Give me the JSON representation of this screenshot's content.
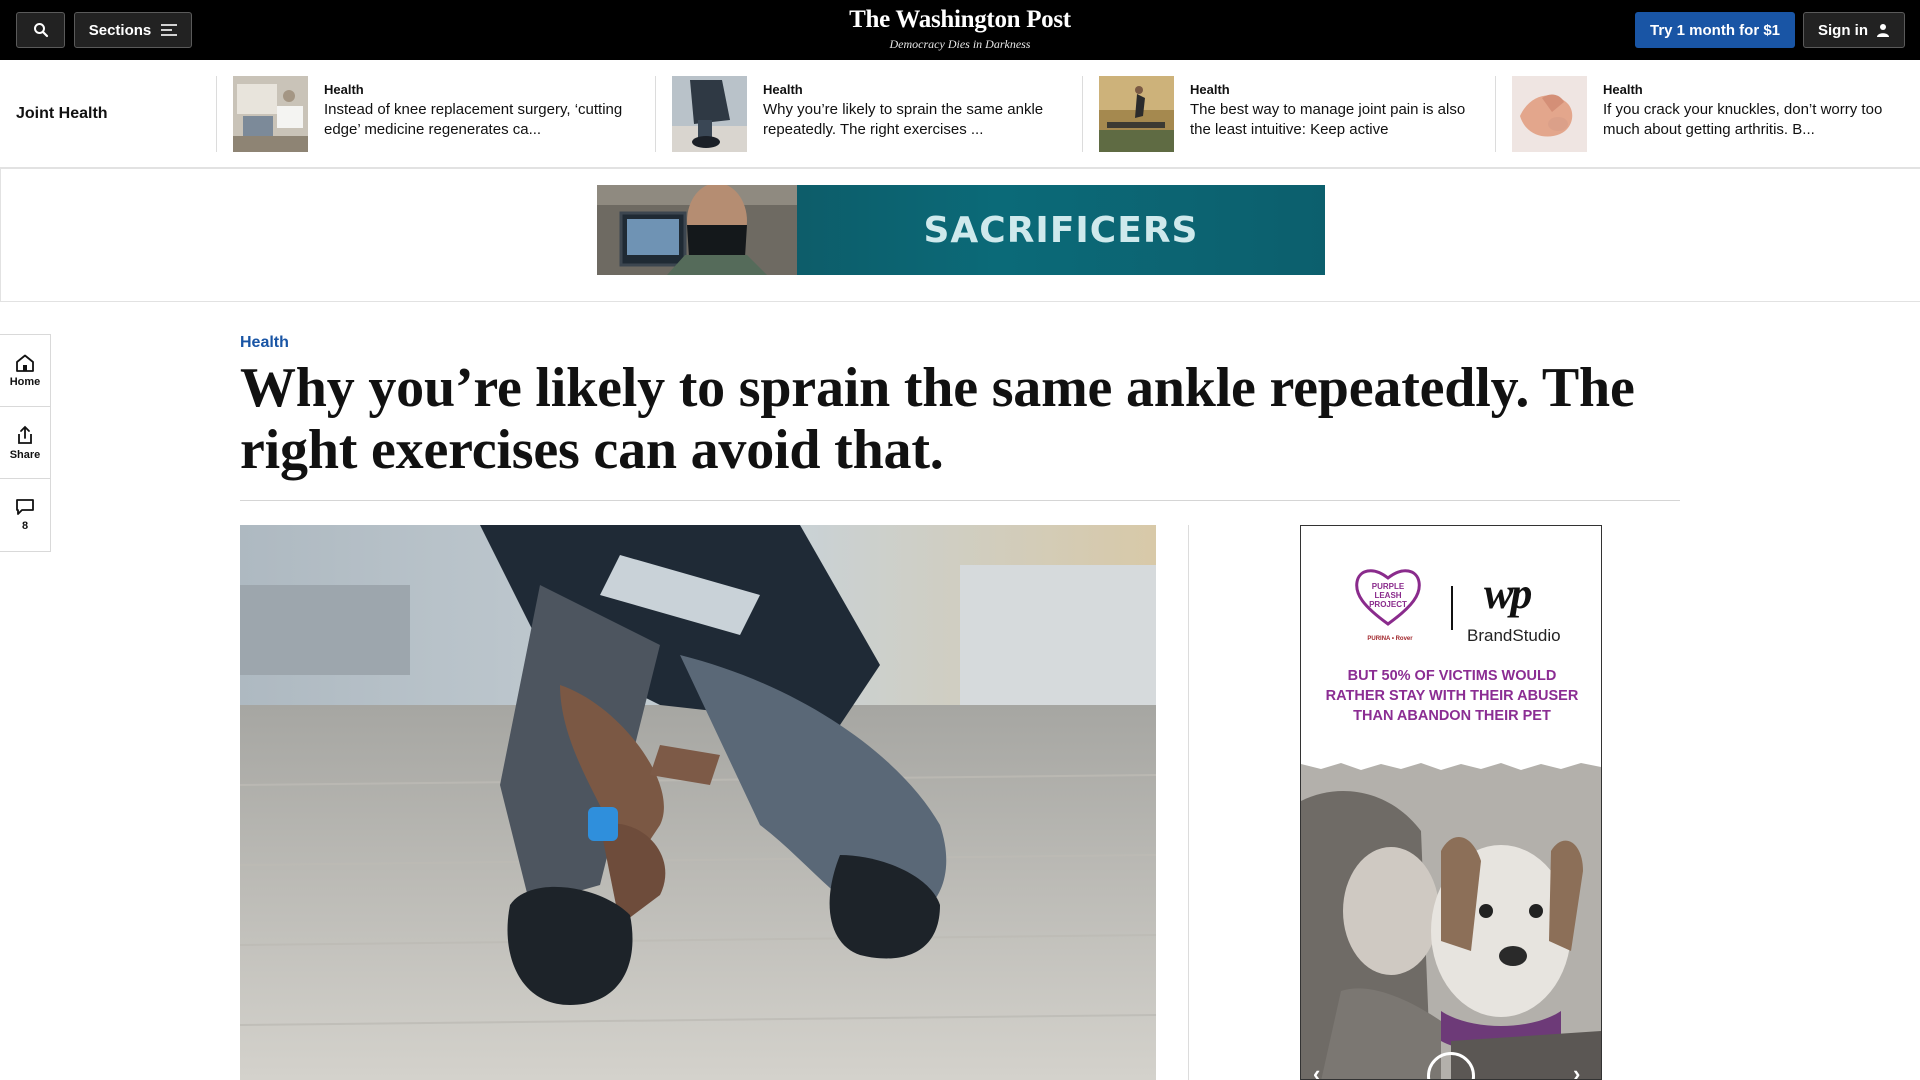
{
  "header": {
    "sections_label": "Sections",
    "logo": "The Washington Post",
    "tagline": "Democracy Dies in Darkness",
    "subscribe_label": "Try 1 month for $1",
    "signin_label": "Sign in"
  },
  "strip": {
    "title": "Joint Health",
    "items": [
      {
        "kicker": "Health",
        "headline": "Instead of knee replacement surgery, ‘cutting edge’ medicine regenerates ca..."
      },
      {
        "kicker": "Health",
        "headline": "Why you’re likely to sprain the same ankle repeatedly. The right exercises ..."
      },
      {
        "kicker": "Health",
        "headline": "The best way to manage joint pain is also the least intuitive: Keep active"
      },
      {
        "kicker": "Health",
        "headline": "If you crack your knuckles, don’t worry too much about getting arthritis. B..."
      }
    ]
  },
  "ad_banner": {
    "text": "SACRIFICERS"
  },
  "rail": {
    "home_label": "Home",
    "share_label": "Share",
    "comments_count": "8"
  },
  "article": {
    "kicker": "Health",
    "headline": "Why you’re likely to sprain the same ankle repeatedly. The right exercises can avoid that."
  },
  "side_ad": {
    "logo_text": "PURPLE LEASH PROJECT",
    "sponsor": "PURINA • Rover",
    "wp_mark": "wp",
    "brand": "BrandStudio",
    "message": "BUT 50% OF VICTIMS WOULD RATHER STAY WITH THEIR ABUSER THAN ABANDON THEIR PET"
  },
  "colors": {
    "accent_blue": "#1955a5",
    "ad_purple": "#8b2d93",
    "ad_teal": "#0b6a78"
  }
}
